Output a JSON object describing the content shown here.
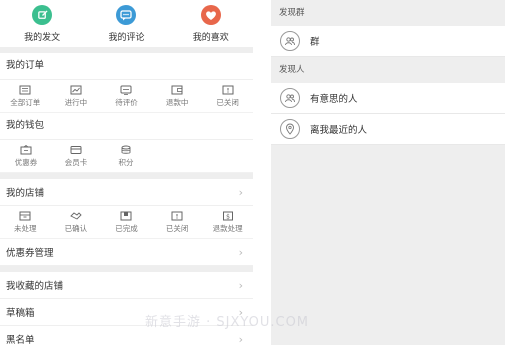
{
  "top_actions": [
    {
      "label": "我的发文",
      "color": "#3bbf8f",
      "icon": "edit-icon"
    },
    {
      "label": "我的评论",
      "color": "#3c9ad6",
      "icon": "comment-icon"
    },
    {
      "label": "我的喜欢",
      "color": "#e8674b",
      "icon": "heart-icon"
    }
  ],
  "orders": {
    "title": "我的订单",
    "items": [
      "全部订单",
      "进行中",
      "待评价",
      "退款中",
      "已关闭"
    ]
  },
  "wallet": {
    "title": "我的钱包",
    "items": [
      "优惠券",
      "会员卡",
      "积分"
    ]
  },
  "shop": {
    "title": "我的店铺",
    "items": [
      "未处理",
      "已确认",
      "已完成",
      "已关闭",
      "退款处理"
    ]
  },
  "coupon_manage": "优惠券管理",
  "fav_shop": "我收藏的店铺",
  "drafts": "草稿箱",
  "blacklist": "黑名单",
  "right_panel": {
    "groups_header": "发现群",
    "groups_item": "群",
    "people_header": "发现人",
    "people_items": [
      "有意思的人",
      "离我最近的人"
    ]
  },
  "watermark": "新意手游 · SJXYOU.COM"
}
